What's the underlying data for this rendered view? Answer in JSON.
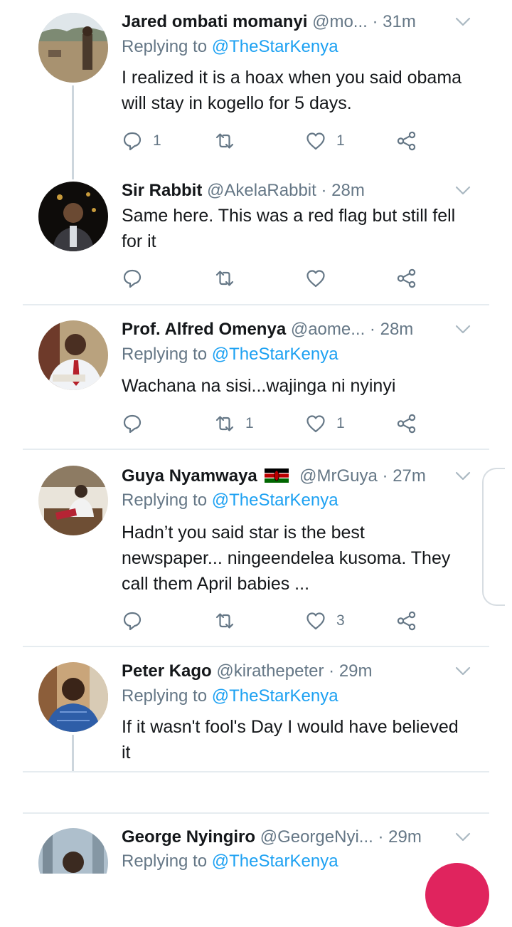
{
  "mention": "@TheStarKenya",
  "replying_prefix": "Replying to ",
  "tweets": [
    {
      "name": "Jared ombati momanyi",
      "handle": "@mo...",
      "time": "31m",
      "text": "I realized it is a hoax when you said obama will stay in kogello for 5 days.",
      "reply_count": "1",
      "retweet_count": "",
      "like_count": "1"
    },
    {
      "name": "Sir Rabbit",
      "handle": "@AkelaRabbit",
      "time": "28m",
      "text": "Same here. This was a red flag but still fell for it",
      "reply_count": "",
      "retweet_count": "",
      "like_count": ""
    },
    {
      "name": "Prof. Alfred Omenya",
      "handle": "@aome...",
      "time": "28m",
      "text": "Wachana na sisi...wajinga ni nyinyi",
      "reply_count": "",
      "retweet_count": "1",
      "like_count": "1"
    },
    {
      "name": "Guya Nyamwaya",
      "handle": "@MrGuya",
      "time": "27m",
      "text": "Hadn’t you said star is the best newspaper... ningeendelea kusoma. They call them April babies ...",
      "reply_count": "",
      "retweet_count": "",
      "like_count": "3"
    },
    {
      "name": "Peter Kago",
      "handle": "@kirathepeter",
      "time": "29m",
      "text": "If it wasn't fool's Day I would have believed it",
      "reply_count": "",
      "retweet_count": "",
      "like_count": ""
    },
    {
      "name": "George Nyingiro",
      "handle": "@GeorgeNyi...",
      "time": "29m",
      "text": "",
      "reply_count": "",
      "retweet_count": "",
      "like_count": ""
    }
  ],
  "colors": {
    "name": "#14171a",
    "muted": "#657786",
    "link": "#1da1f2",
    "divider": "#e6ecf0",
    "fab": "#e0245e"
  },
  "icons": [
    "reply-icon",
    "retweet-icon",
    "like-icon",
    "share-icon",
    "chevron-down-icon",
    "kenya-flag-icon"
  ]
}
